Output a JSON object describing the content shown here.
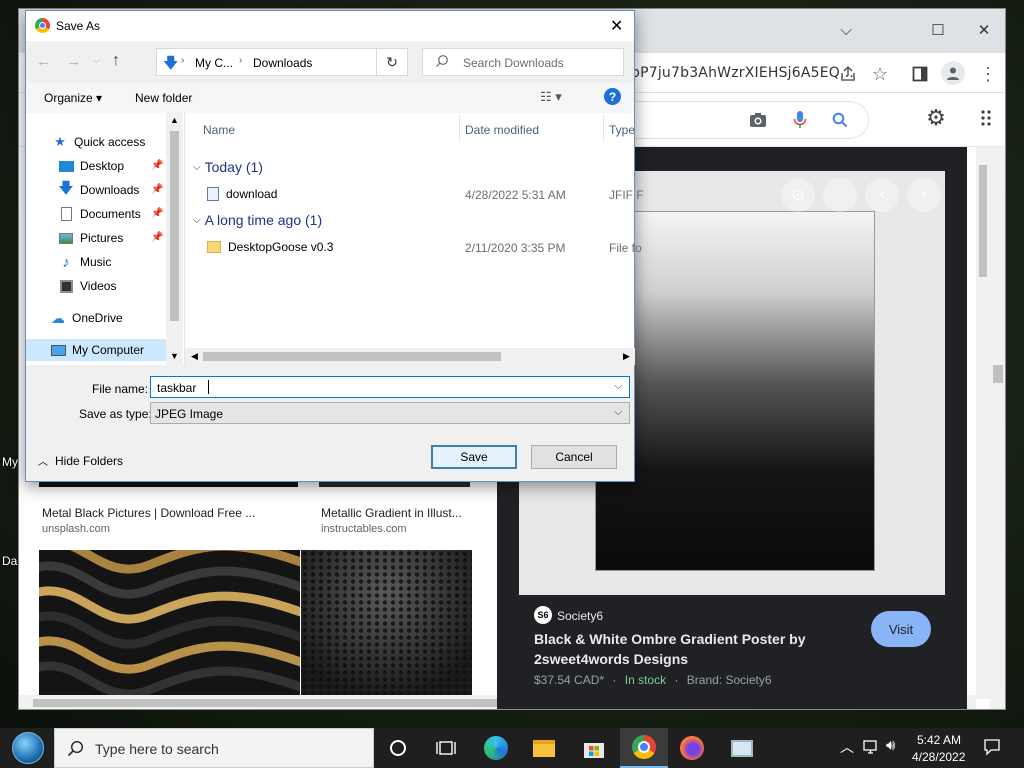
{
  "desktop": {
    "label_my": "My",
    "label_da": "Da"
  },
  "chrome": {
    "url_tail": "pP7ju7b3AhWzrXIEHSj6A5EQ...",
    "window_minimize": "⌵",
    "window_restore": "☐",
    "window_close": "✕"
  },
  "results": [
    {
      "title": "Metal Black Pictures | Download Free ...",
      "source": "unsplash.com"
    },
    {
      "title": "Metallic Gradient in Illust...",
      "source": "instructables.com"
    }
  ],
  "panel": {
    "site_badge": "S6",
    "site_name": "Society6",
    "title_line1": "Black & White Ombre Gradient Poster by",
    "title_line2": "2sweet4words Designs",
    "price": "$37.54 CAD*",
    "dot": "·",
    "stock": "In stock",
    "brand": "Brand: Society6",
    "visit_label": "Visit"
  },
  "dialog": {
    "title": "Save As",
    "breadcrumb": [
      "My C...",
      "Downloads"
    ],
    "search_placeholder": "Search Downloads",
    "organize_label": "Organize ▾",
    "new_folder_label": "New folder",
    "nav": {
      "quick_access": "Quick access",
      "items": [
        "Desktop",
        "Downloads",
        "Documents",
        "Pictures",
        "Music",
        "Videos"
      ],
      "onedrive": "OneDrive",
      "my_computer": "My Computer"
    },
    "columns": {
      "name": "Name",
      "date": "Date modified",
      "type": "Type"
    },
    "groups": [
      {
        "label": "Today (1)",
        "file": "download",
        "date": "4/28/2022 5:31 AM",
        "type": "JFIF F"
      },
      {
        "label": "A long time ago (1)",
        "file": "DesktopGoose v0.3",
        "date": "2/11/2020 3:35 PM",
        "type": "File fo"
      }
    ],
    "file_name_label": "File name:",
    "file_name_value": "taskbar",
    "save_type_label": "Save as type:",
    "save_type_value": "JPEG Image",
    "hide_folders_label": "Hide Folders",
    "save_label": "Save",
    "cancel_label": "Cancel"
  },
  "taskbar": {
    "search_placeholder": "Type here to search",
    "time": "5:42 AM",
    "date": "4/28/2022"
  },
  "colors": {
    "accent": "#0078d7",
    "chrome_tabbar": "#dee1e6",
    "panel_bg": "#202124",
    "visit": "#8ab4f8",
    "in_stock": "#81c995"
  }
}
